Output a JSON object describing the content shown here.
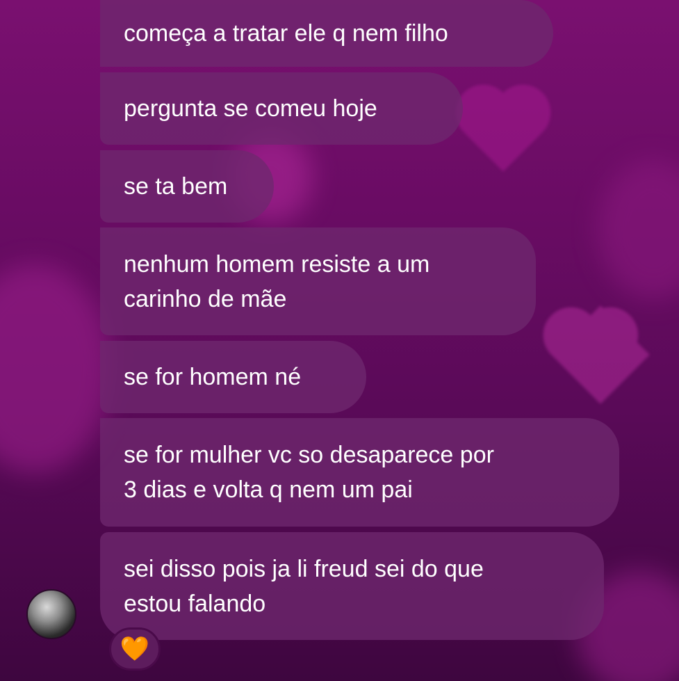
{
  "messages": [
    {
      "text": "começa a tratar ele q nem filho"
    },
    {
      "text": "pergunta se comeu hoje"
    },
    {
      "text": "se ta bem"
    },
    {
      "text": "nenhum homem resiste a um\ncarinho de mãe"
    },
    {
      "text": "se for homem né"
    },
    {
      "text": "se for mulher vc so desaparece por\n3 dias e volta q nem um pai"
    },
    {
      "text": "sei disso pois ja li freud sei do que\nestou falando"
    }
  ],
  "reaction": {
    "emoji": "🧡"
  },
  "colors": {
    "background": "#6a0c64",
    "bubble": "#6e286e",
    "text": "#ffffff",
    "reaction_heart": "#ff9a1f"
  },
  "icons": {
    "avatar": "user-avatar",
    "reaction": "orange-heart-icon"
  }
}
